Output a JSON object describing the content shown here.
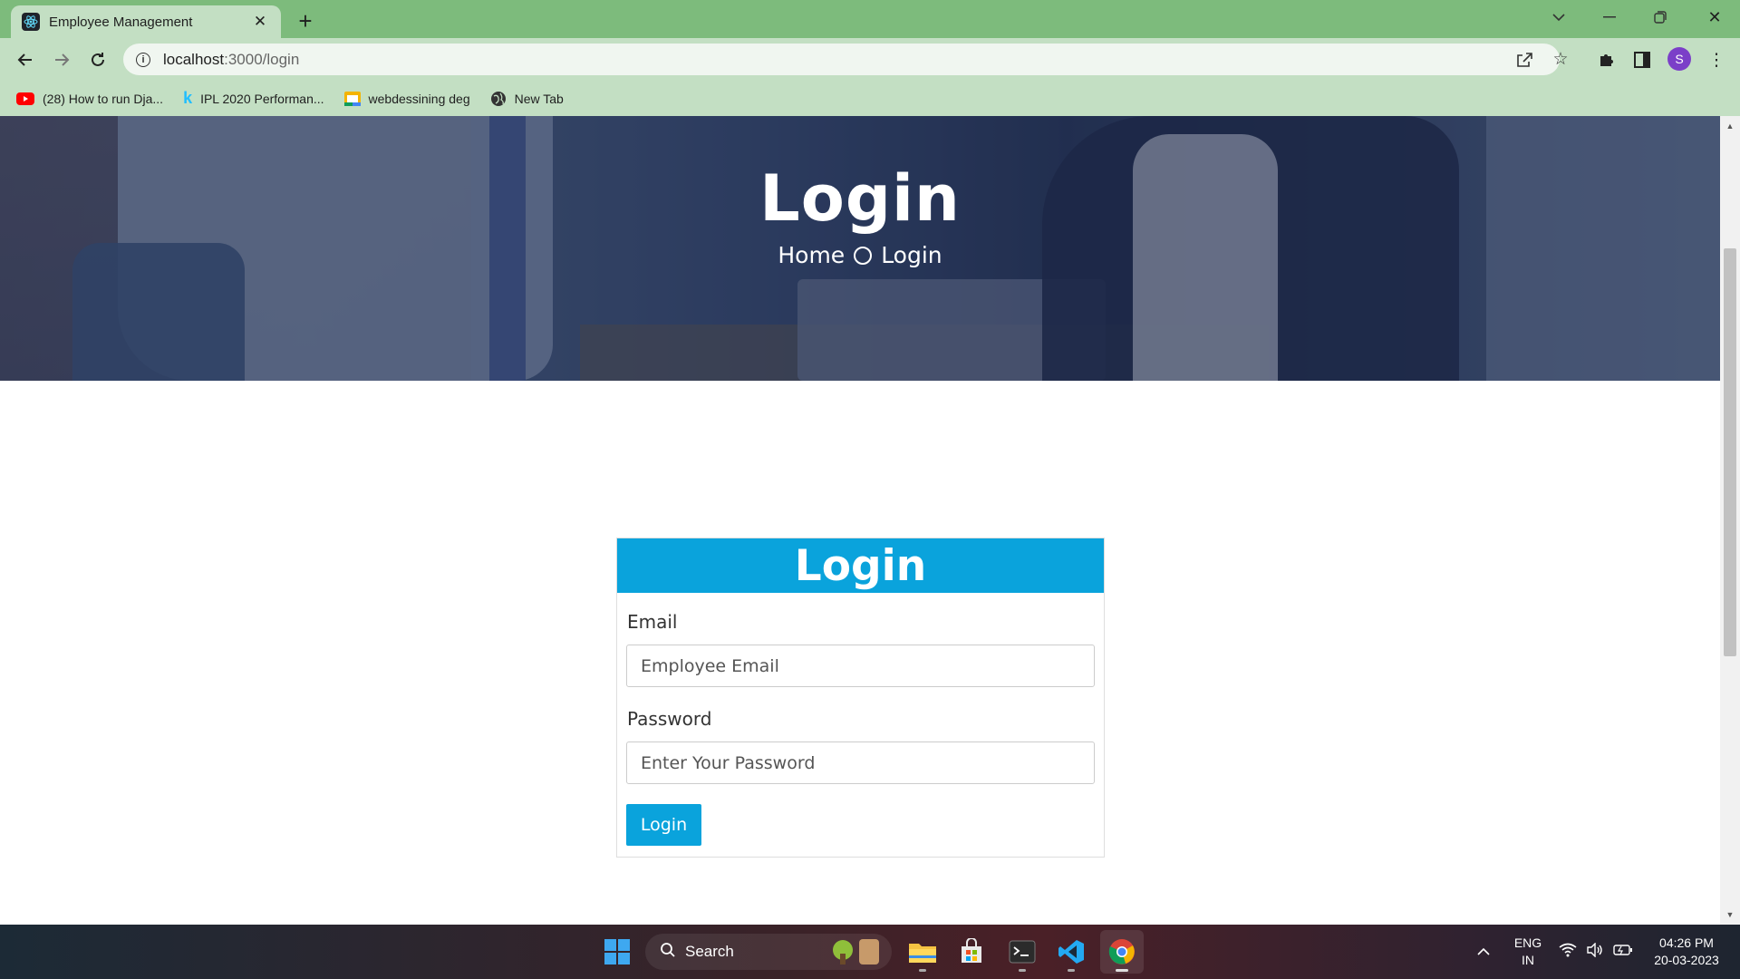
{
  "browser": {
    "tab_title": "Employee Management",
    "url_host": "localhost",
    "url_path": ":3000/login",
    "profile_initial": "S",
    "bookmarks": [
      {
        "label": "(28) How to run Dja...",
        "icon": "youtube-icon"
      },
      {
        "label": "IPL 2020 Performan...",
        "icon": "kaggle-icon"
      },
      {
        "label": "webdessining deg",
        "icon": "google-slides-icon"
      },
      {
        "label": "New Tab",
        "icon": "globe-icon"
      }
    ]
  },
  "hero": {
    "title": "Login",
    "breadcrumb": {
      "home": "Home",
      "current": "Login"
    }
  },
  "login_form": {
    "heading": "Login",
    "email_label": "Email",
    "email_placeholder": "Employee Email",
    "email_value": "",
    "password_label": "Password",
    "password_placeholder": "Enter Your Password",
    "password_value": "",
    "submit_label": "Login"
  },
  "taskbar": {
    "search_label": "Search",
    "lang_primary": "ENG",
    "lang_secondary": "IN",
    "time": "04:26 PM",
    "date": "20-03-2023"
  },
  "colors": {
    "accent": "#0aa3dc",
    "chrome_tabbar": "#7dbb7c",
    "chrome_toolbar": "#c3dfc3"
  }
}
